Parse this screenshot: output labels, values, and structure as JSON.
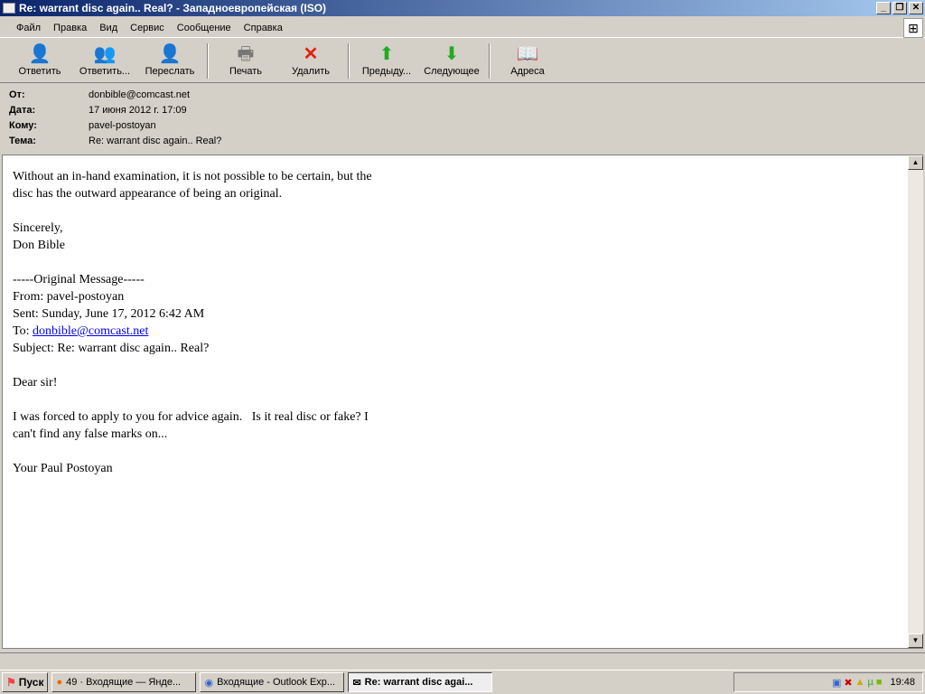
{
  "window": {
    "title": "Re: warrant disc again.. Real? - Западноевропейская (ISO)"
  },
  "menu": [
    "Файл",
    "Правка",
    "Вид",
    "Сервис",
    "Сообщение",
    "Справка"
  ],
  "toolbar": [
    {
      "label": "Ответить",
      "icon": "reply-icon"
    },
    {
      "label": "Ответить...",
      "icon": "reply-all-icon"
    },
    {
      "label": "Переслать",
      "icon": "forward-icon"
    },
    {
      "label": "Печать",
      "icon": "print-icon"
    },
    {
      "label": "Удалить",
      "icon": "delete-icon"
    },
    {
      "label": "Предыду...",
      "icon": "previous-icon"
    },
    {
      "label": "Следующее",
      "icon": "next-icon"
    },
    {
      "label": "Адреса",
      "icon": "address-book-icon"
    }
  ],
  "header": {
    "from_label": "От:",
    "from": "donbible@comcast.net",
    "date_label": "Дата:",
    "date": "17 июня 2012 г. 17:09",
    "to_label": "Кому:",
    "to": "pavel-postoyan",
    "subject_label": "Тема:",
    "subject": "Re: warrant disc again.. Real?"
  },
  "message": {
    "part1": "Without an in-hand examination, it is not possible to be certain, but the\ndisc has the outward appearance of being an original.\n\nSincerely,\nDon Bible\n\n-----Original Message-----\nFrom: pavel-postoyan\nSent: Sunday, June 17, 2012 6:42 AM\nTo: ",
    "link": "donbible@comcast.net",
    "part2": "\nSubject: Re: warrant disc again.. Real?\n\nDear sir!\n\nI was forced to apply to you for advice again.   Is it real disc or fake? I\ncan't find any false marks on...\n\nYour Paul Postoyan"
  },
  "taskbar": {
    "start": "Пуск",
    "tasks": [
      "49 · Входящие — Янде...",
      "Входящие - Outlook Exp...",
      "Re: warrant disc agai..."
    ],
    "clock": "19:48"
  }
}
